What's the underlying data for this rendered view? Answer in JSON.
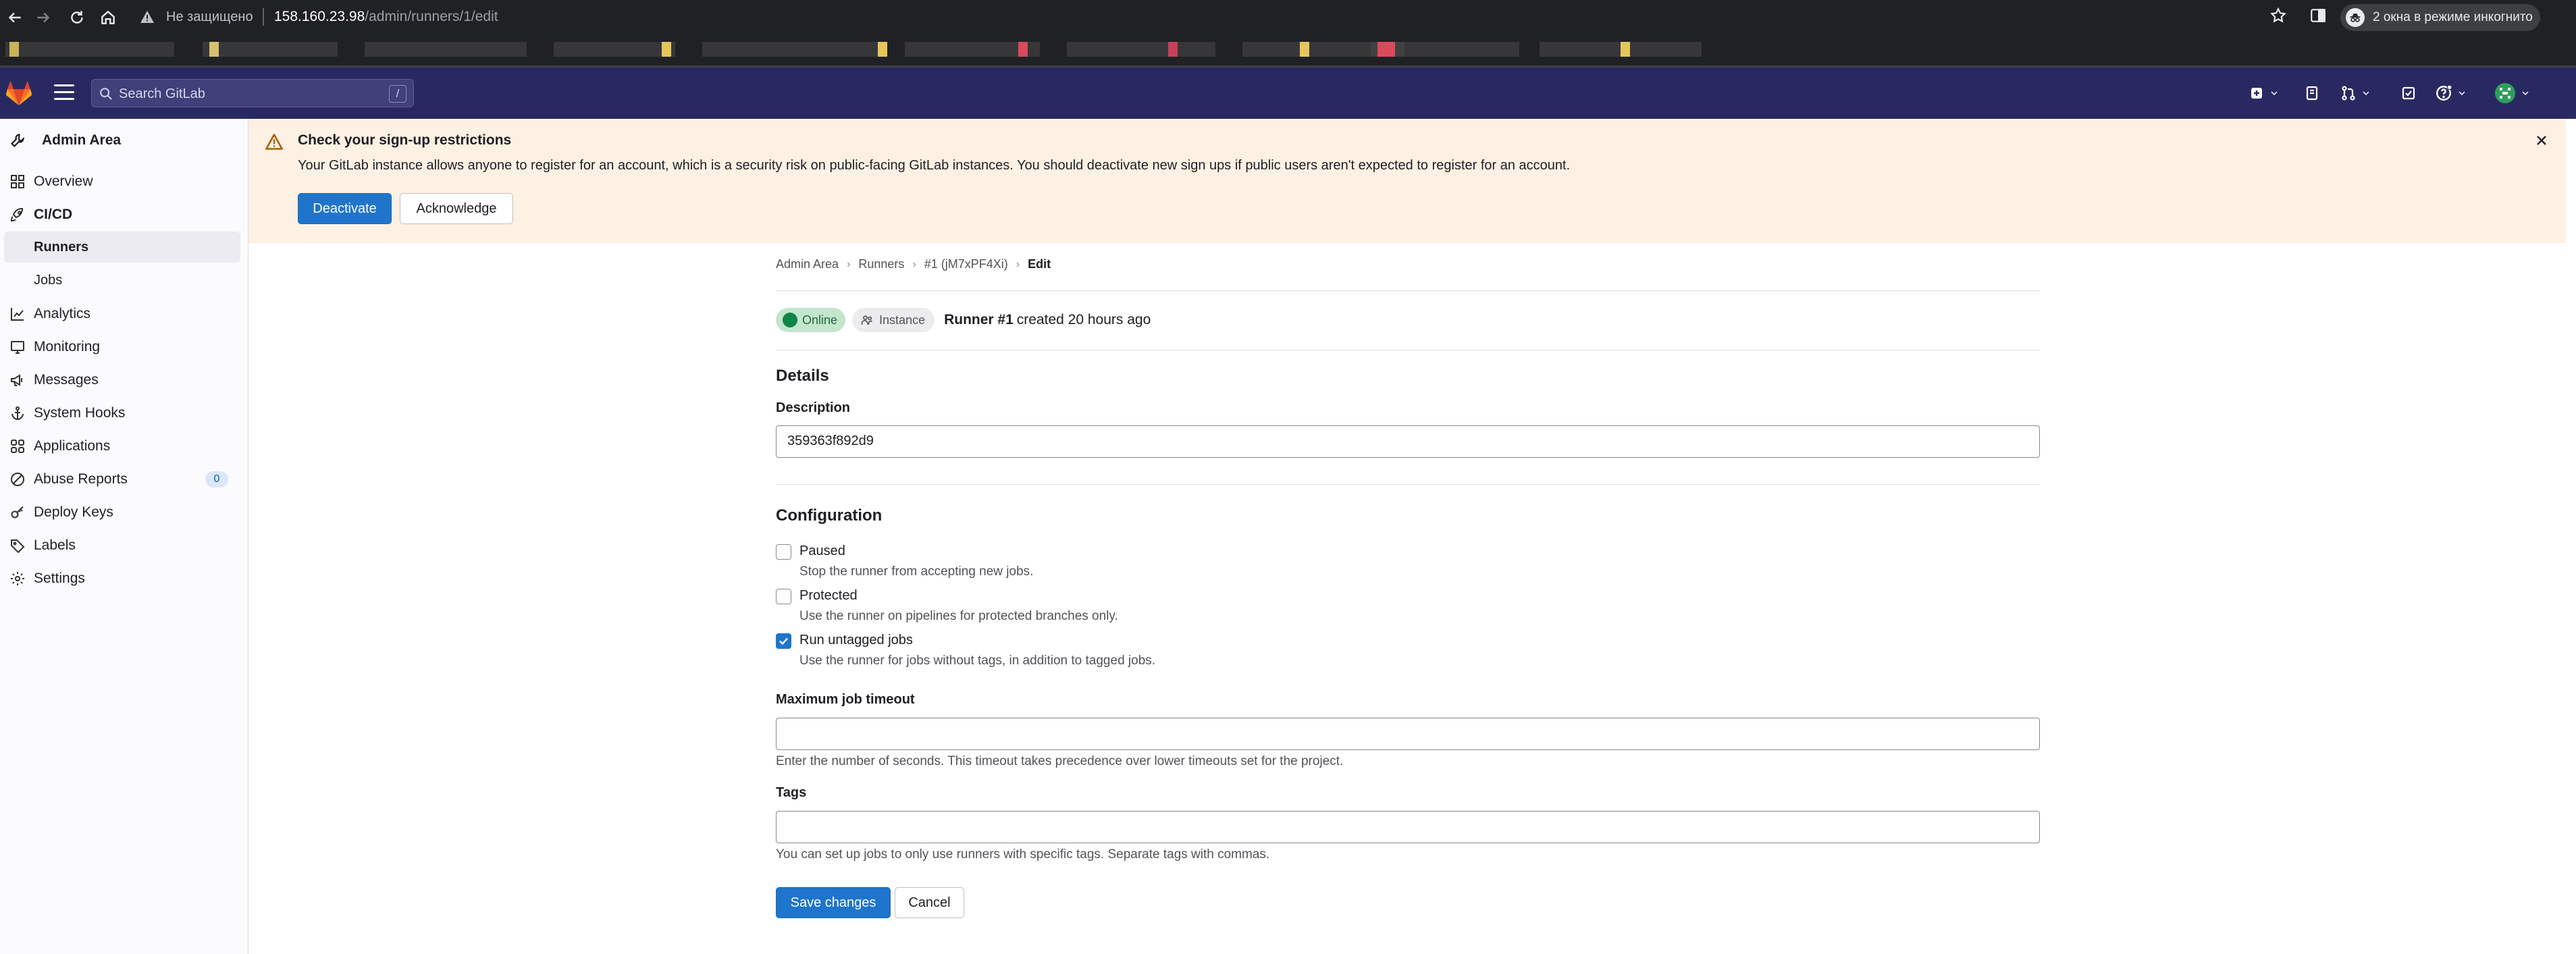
{
  "browser": {
    "insecure_label": "Не защищено",
    "url_host": "158.160.23.98",
    "url_path": "/admin/runners/1/edit",
    "incognito_label": "2 окна в режиме инкогнито"
  },
  "navbar": {
    "search_placeholder": "Search GitLab",
    "search_shortcut": "/"
  },
  "sidebar": {
    "title": "Admin Area",
    "items": [
      {
        "label": "Overview"
      },
      {
        "label": "CI/CD"
      },
      {
        "label": "Runners"
      },
      {
        "label": "Jobs"
      },
      {
        "label": "Analytics"
      },
      {
        "label": "Monitoring"
      },
      {
        "label": "Messages"
      },
      {
        "label": "System Hooks"
      },
      {
        "label": "Applications"
      },
      {
        "label": "Abuse Reports",
        "badge": "0"
      },
      {
        "label": "Deploy Keys"
      },
      {
        "label": "Labels"
      },
      {
        "label": "Settings"
      }
    ]
  },
  "alert": {
    "title": "Check your sign-up restrictions",
    "body": "Your GitLab instance allows anyone to register for an account, which is a security risk on public-facing GitLab instances. You should deactivate new sign ups if public users aren't expected to register for an account.",
    "deactivate_label": "Deactivate",
    "acknowledge_label": "Acknowledge"
  },
  "breadcrumb": [
    "Admin Area",
    "Runners",
    "#1 (jM7xPF4Xi)",
    "Edit"
  ],
  "runner": {
    "status": "Online",
    "type": "Instance",
    "name": "Runner #1",
    "created": "created 20 hours ago"
  },
  "details": {
    "heading": "Details",
    "description_label": "Description",
    "description_value": "359363f892d9"
  },
  "configuration": {
    "heading": "Configuration",
    "options": [
      {
        "label": "Paused",
        "help": "Stop the runner from accepting new jobs.",
        "checked": false
      },
      {
        "label": "Protected",
        "help": "Use the runner on pipelines for protected branches only.",
        "checked": false
      },
      {
        "label": "Run untagged jobs",
        "help": "Use the runner for jobs without tags, in addition to tagged jobs.",
        "checked": true
      }
    ],
    "timeout_label": "Maximum job timeout",
    "timeout_value": "",
    "timeout_help": "Enter the number of seconds. This timeout takes precedence over lower timeouts set for the project.",
    "tags_label": "Tags",
    "tags_value": "",
    "tags_help": "You can set up jobs to only use runners with specific tags. Separate tags with commas."
  },
  "actions": {
    "save_label": "Save changes",
    "cancel_label": "Cancel"
  },
  "colors": {
    "navbar": "#292961",
    "primary": "#1f75cb",
    "alert_bg": "#fcf1e3",
    "online_badge": "#c3e6cd"
  }
}
